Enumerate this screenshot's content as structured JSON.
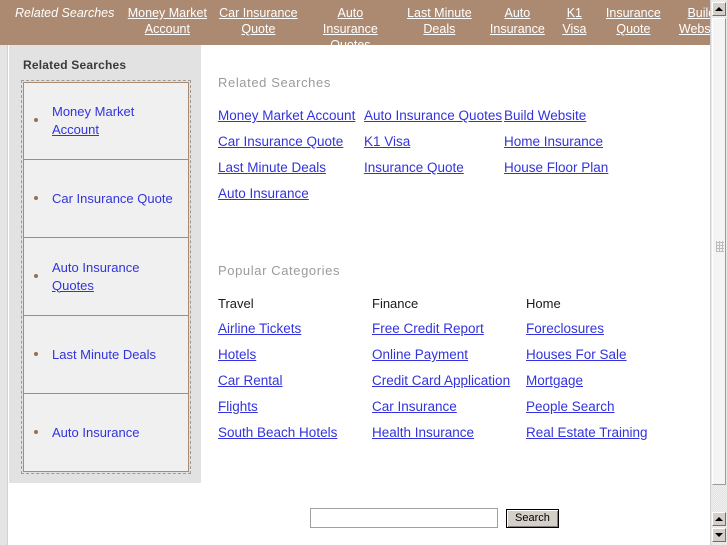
{
  "topbar": {
    "label": "Related Searches",
    "links": [
      "Money Market Account",
      "Car Insurance Quote",
      "Auto Insurance Quotes",
      "Last Minute Deals",
      "Auto Insurance",
      "K1 Visa",
      "Insurance Quote",
      "Build Website"
    ]
  },
  "sidebar": {
    "title": "Related Searches",
    "items": [
      {
        "line1": "Money Market",
        "line2": "Account"
      },
      {
        "line1": "Car Insurance Quote",
        "line2": ""
      },
      {
        "line1": "Auto Insurance",
        "line2": "Quotes"
      },
      {
        "line1": "Last Minute Deals",
        "line2": ""
      },
      {
        "line1": "Auto Insurance",
        "line2": ""
      }
    ]
  },
  "related": {
    "title": "Related Searches",
    "links": [
      "Money Market Account",
      "Auto Insurance Quotes",
      "Build Website",
      "Car Insurance Quote",
      "K1 Visa",
      "Home Insurance",
      "Last Minute Deals",
      "Insurance Quote",
      "House Floor Plan",
      "Auto Insurance",
      "",
      ""
    ]
  },
  "categories": {
    "title": "Popular Categories",
    "columns": [
      {
        "head": "Travel",
        "links": [
          "Airline Tickets",
          "Hotels",
          "Car Rental",
          "Flights",
          "South Beach Hotels"
        ]
      },
      {
        "head": "Finance",
        "links": [
          "Free Credit Report",
          "Online Payment",
          "Credit Card Application",
          "Car Insurance",
          "Health Insurance"
        ]
      },
      {
        "head": "Home",
        "links": [
          "Foreclosures",
          "Houses For Sale",
          "Mortgage",
          "People Search",
          "Real Estate Training"
        ]
      }
    ]
  },
  "search": {
    "value": "",
    "placeholder": "",
    "button_label": "Search"
  },
  "colors": {
    "topbar_bg": "#ab8a71",
    "sidebar_bg": "#e2e2e2",
    "link": "#3333dd",
    "section_title": "#9b9b9b",
    "box_border": "#ab8a71",
    "bullet": "#9a6f4e"
  }
}
